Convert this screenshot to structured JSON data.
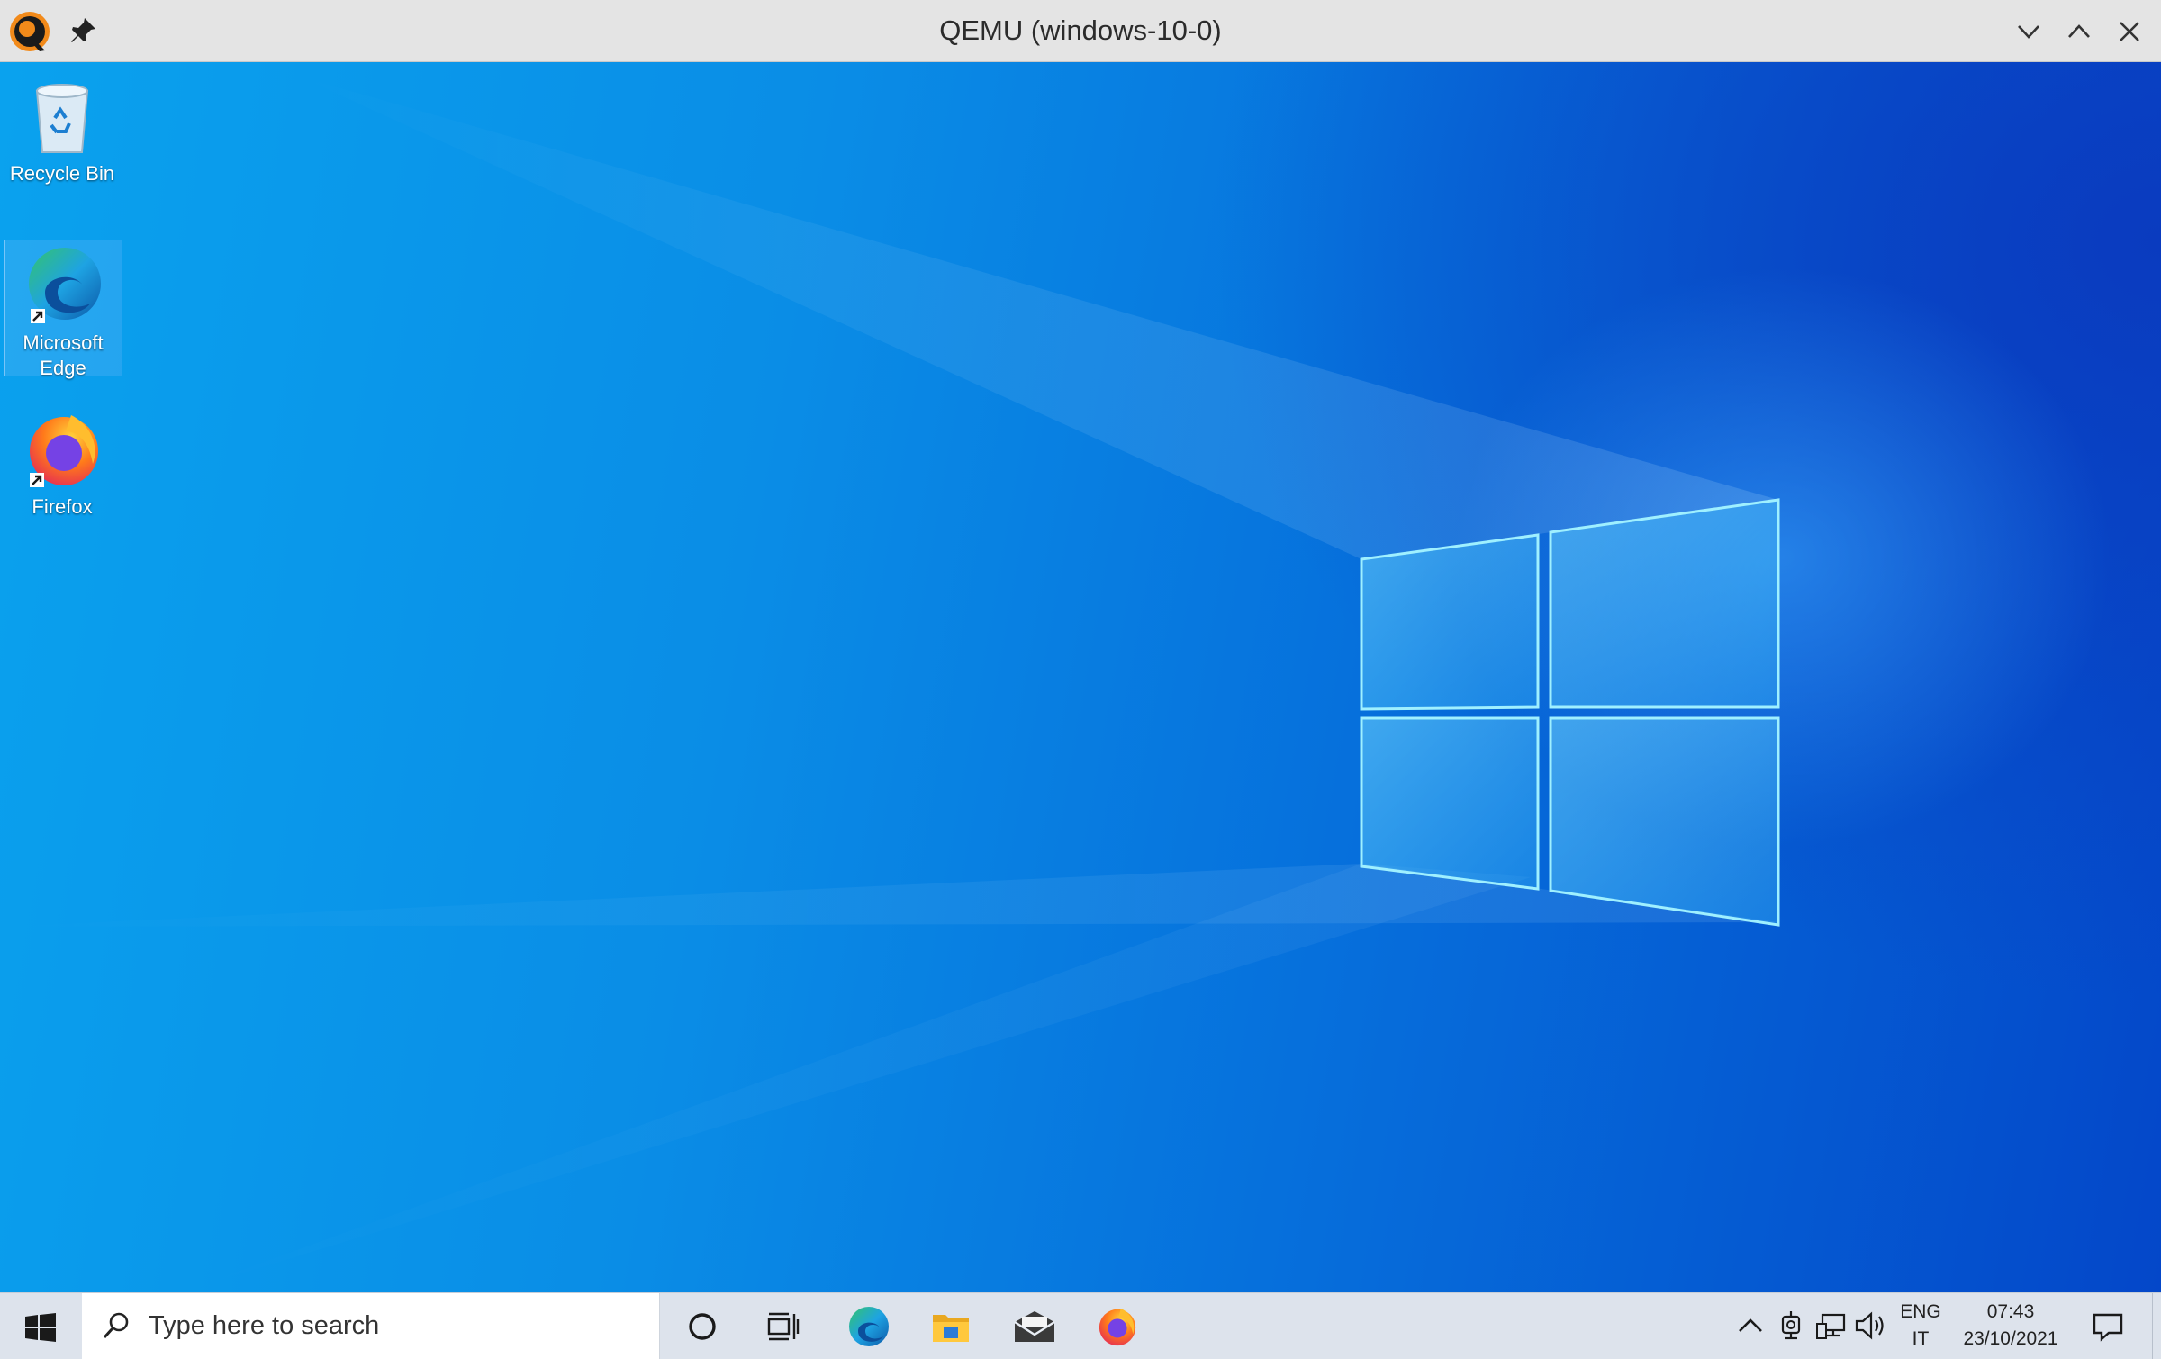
{
  "window": {
    "title": "QEMU (windows-10-0)",
    "icons": [
      "qemu-logo-icon",
      "pin-icon",
      "chevron-down-icon",
      "chevron-up-icon",
      "close-icon"
    ]
  },
  "desktop": {
    "icons": [
      {
        "label": "Recycle Bin",
        "icon": "recycle-bin-icon",
        "selected": false
      },
      {
        "label": "Microsoft Edge",
        "icon": "edge-icon",
        "selected": true,
        "shortcut": true
      },
      {
        "label": "Firefox",
        "icon": "firefox-icon",
        "selected": false,
        "shortcut": true
      }
    ]
  },
  "taskbar": {
    "search_placeholder": "Type here to search",
    "pinned": [
      "cortana-icon",
      "task-view-icon",
      "edge-icon",
      "file-explorer-icon",
      "mail-icon",
      "firefox-icon"
    ],
    "tray": {
      "icons": [
        "chevron-up-icon",
        "webcam-icon",
        "network-icon",
        "volume-icon"
      ],
      "lang_top": "ENG",
      "lang_bottom": "IT",
      "time": "07:43",
      "date": "23/10/2021"
    }
  },
  "colors": {
    "titlebar": "#e4e4e4",
    "desktop_light": "#0aa2ee",
    "desktop_dark": "#0447c9",
    "taskbar": "#dde3ec"
  }
}
